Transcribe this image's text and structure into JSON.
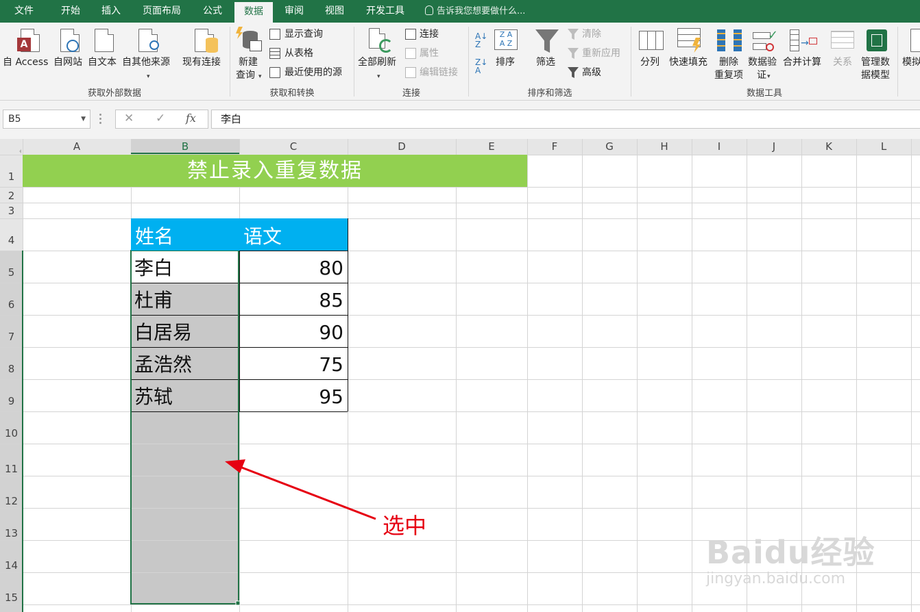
{
  "tabs": [
    {
      "label": "文件",
      "active": false
    },
    {
      "label": "开始",
      "active": false
    },
    {
      "label": "插入",
      "active": false
    },
    {
      "label": "页面布局",
      "active": false
    },
    {
      "label": "公式",
      "active": false
    },
    {
      "label": "数据",
      "active": true
    },
    {
      "label": "审阅",
      "active": false
    },
    {
      "label": "视图",
      "active": false
    },
    {
      "label": "开发工具",
      "active": false
    }
  ],
  "tell_me": "告诉我您想要做什么...",
  "ribbon": {
    "external": {
      "access": "自 Access",
      "web": "自网站",
      "text": "自文本",
      "other": "自其他来源",
      "existing": "现有连接",
      "group": "获取外部数据"
    },
    "transform": {
      "new_query_1": "新建",
      "new_query_2": "查询",
      "show_queries": "显示查询",
      "from_table": "从表格",
      "recent_sources": "最近使用的源",
      "group": "获取和转换"
    },
    "connections": {
      "refresh_all": "全部刷新",
      "connections": "连接",
      "properties": "属性",
      "edit_links": "编辑链接",
      "group": "连接"
    },
    "sort_filter": {
      "sort": "排序",
      "filter": "筛选",
      "clear": "清除",
      "reapply": "重新应用",
      "advanced": "高级",
      "group": "排序和筛选"
    },
    "data_tools": {
      "text_to_columns": "分列",
      "flash_fill": "快速填充",
      "remove_dup_1": "删除",
      "remove_dup_2": "重复项",
      "validation_1": "数据验",
      "validation_2": "证",
      "consolidate": "合并计算",
      "relationships": "关系",
      "data_model_1": "管理数",
      "data_model_2": "据模型",
      "group": "数据工具"
    },
    "forecast": {
      "what_if": "模拟"
    }
  },
  "formula_bar": {
    "name_box": "B5",
    "fx_label": "fx",
    "value": "李白"
  },
  "columns": [
    "A",
    "B",
    "C",
    "D",
    "E",
    "F",
    "G",
    "H",
    "I",
    "J",
    "K",
    "L"
  ],
  "rows": [
    "1",
    "2",
    "3",
    "4",
    "5",
    "6",
    "7",
    "8",
    "9",
    "10",
    "11",
    "12",
    "13",
    "14",
    "15"
  ],
  "sheet": {
    "title": "禁止录入重复数据",
    "header_name": "姓名",
    "header_score": "语文",
    "records": [
      {
        "name": "李白",
        "score": "80"
      },
      {
        "name": "杜甫",
        "score": "85"
      },
      {
        "name": "白居易",
        "score": "90"
      },
      {
        "name": "孟浩然",
        "score": "75"
      },
      {
        "name": "苏轼",
        "score": "95"
      }
    ]
  },
  "annotation": "选中",
  "watermark": {
    "brand": "Baidu经验",
    "url": "jingyan.baidu.com"
  },
  "colors": {
    "ribbon_tab_bar": "#217346",
    "title_fill": "#92d050",
    "header_fill": "#00b0f0",
    "selection_fill": "#c8c8c8",
    "arrow": "#e60012"
  }
}
